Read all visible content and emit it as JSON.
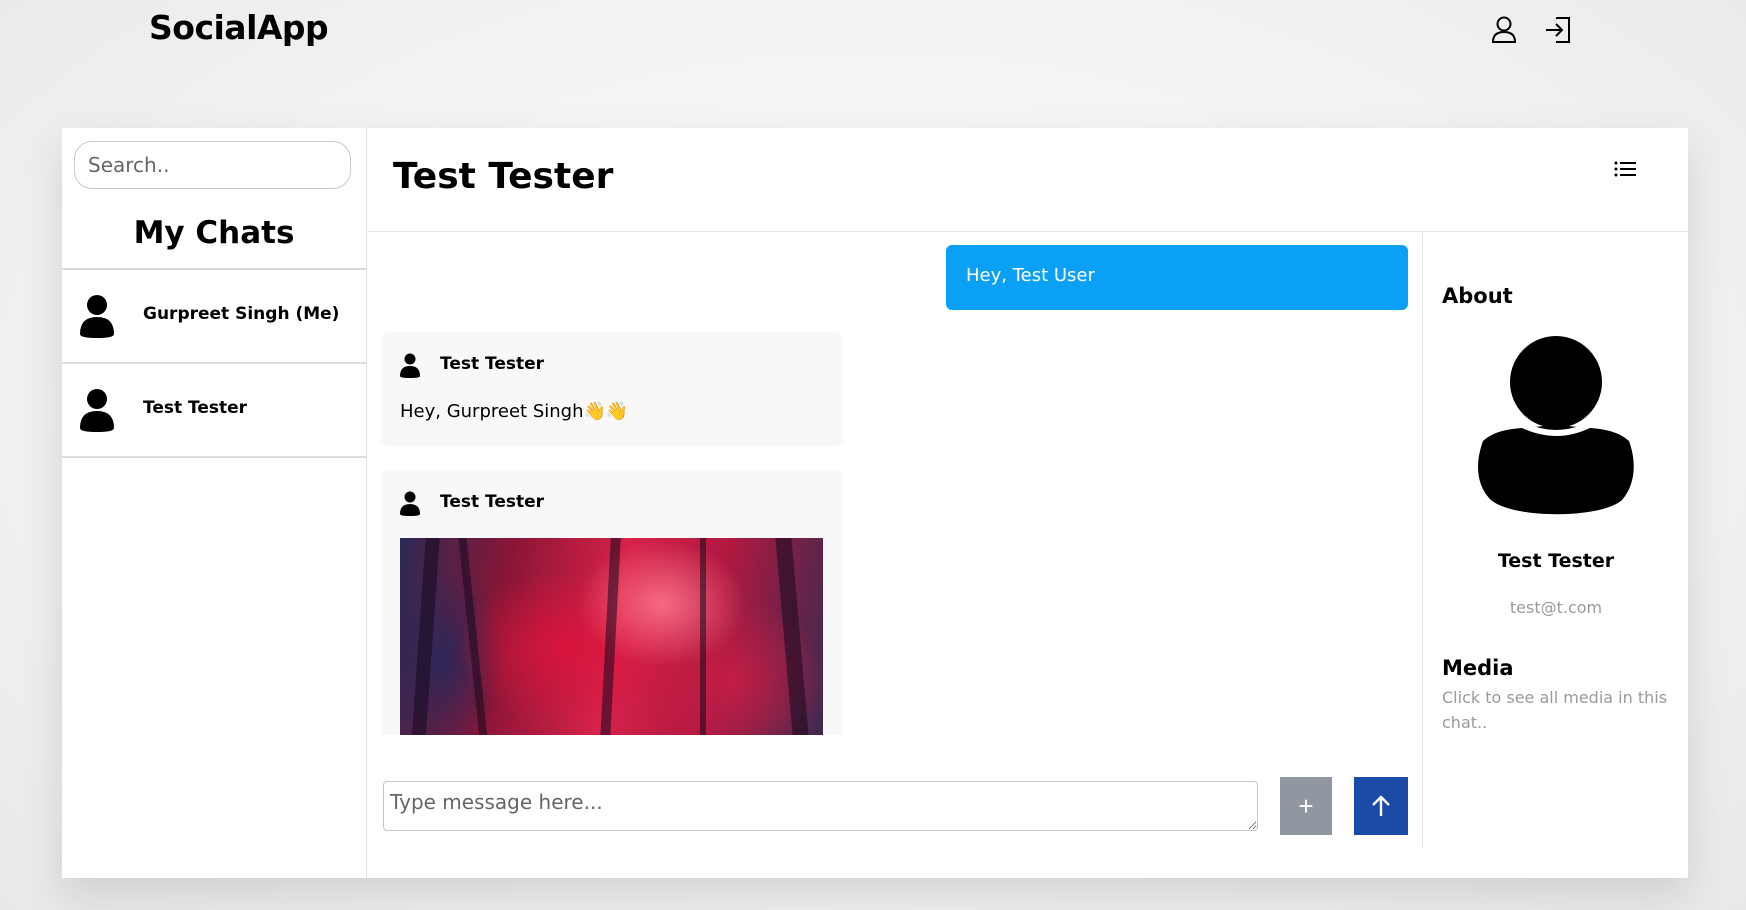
{
  "app": {
    "brand": "SocialApp"
  },
  "topbar": {
    "icons": [
      "user-icon",
      "logout-icon"
    ]
  },
  "sidebar": {
    "search_placeholder": "Search..",
    "title": "My Chats",
    "chats": [
      {
        "name": "Gurpreet Singh (Me)",
        "icon": "person-icon"
      },
      {
        "name": "Test Tester",
        "icon": "person-icon"
      }
    ]
  },
  "chat": {
    "title": "Test Tester",
    "menu_icon": "list-icon",
    "messages": [
      {
        "direction": "outgoing",
        "text": "Hey, Test User"
      },
      {
        "direction": "incoming",
        "sender": "Test Tester",
        "text": "Hey, Gurpreet Singh👋👋"
      },
      {
        "direction": "incoming",
        "sender": "Test Tester",
        "attachment": "image"
      }
    ],
    "composer": {
      "placeholder": "Type message here...",
      "add_label": "+",
      "send_icon": "arrow-up-icon"
    }
  },
  "about": {
    "title": "About",
    "name": "Test Tester",
    "email": "test@t.com",
    "media_title": "Media",
    "media_desc": "Click to see all media in this chat.."
  },
  "colors": {
    "outgoing_bubble": "#0aa0f5",
    "incoming_bubble": "#f8f8f8",
    "send_button": "#1a4ba8",
    "add_button": "#9097a0"
  }
}
